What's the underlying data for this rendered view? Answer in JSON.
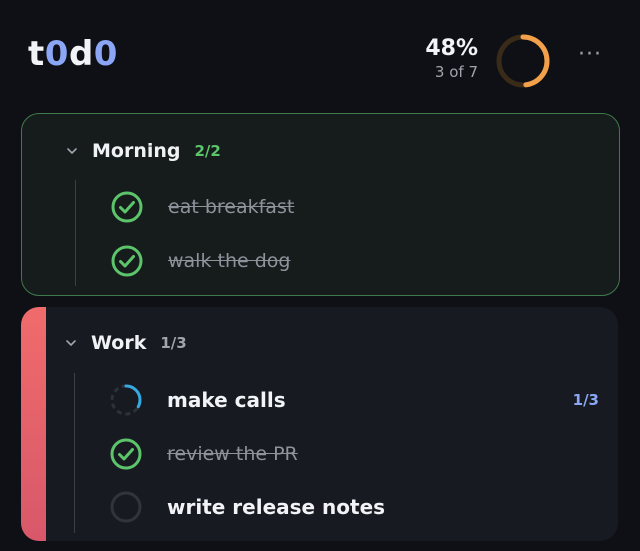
{
  "app": {
    "logo": [
      "t",
      "0",
      "d",
      "0"
    ],
    "logo_colors": [
      "#f2f3f6",
      "#8aa6f5",
      "#f2f3f6",
      "#8aa6f5"
    ]
  },
  "progress": {
    "percent_label": "48%",
    "summary": "3 of 7",
    "ring_fraction": 0.48,
    "ring_color": "#f2a04a",
    "more_label": "···"
  },
  "groups": [
    {
      "title": "Morning",
      "count": "2/2",
      "count_color": "#5cc46a",
      "accent": "#3f7a4a",
      "items": [
        {
          "label": "eat breakfast",
          "status": "done"
        },
        {
          "label": "walk the dog",
          "status": "done"
        }
      ]
    },
    {
      "title": "Work",
      "count": "1/3",
      "count_color": "#a0a4ad",
      "accent": "#f06b6b",
      "items": [
        {
          "label": "make calls",
          "status": "in-progress",
          "count": "1/3",
          "progress": 0.33
        },
        {
          "label": "review the PR",
          "status": "done"
        },
        {
          "label": "write release notes",
          "status": "todo"
        }
      ]
    }
  ],
  "icons": {
    "done": "check-circle-icon",
    "in_progress": "progress-ring-icon",
    "todo": "empty-circle-icon",
    "collapse": "chevron-down-icon"
  },
  "colors": {
    "background": "#0e1015",
    "done_check": "#5cc46a",
    "progress_arc": "#36a9e1",
    "subcount": "#8aa6f5"
  }
}
